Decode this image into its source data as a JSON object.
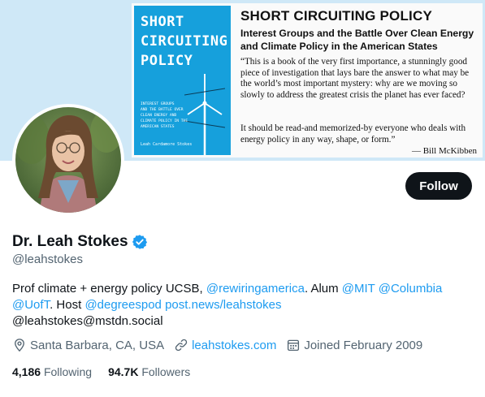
{
  "banner": {
    "book": {
      "title_lines": [
        "SHORT",
        "CIRCUITING",
        "POLICY"
      ],
      "subtitle_lines": [
        "INTEREST GROUPS",
        "AND THE BATTLE OVER",
        "CLEAN ENERGY AND",
        "CLIMATE POLICY IN THE",
        "AMERICAN STATES"
      ],
      "author": "Leah Cardamore Stokes"
    },
    "title": "SHORT CIRCUITING POLICY",
    "subtitle": "Interest Groups and the Battle Over Clean Energy and Climate Policy in the American States",
    "quote1": "“This is a book of the very first importance, a stunningly good piece of investigation that lays bare the answer to what may be the world’s most important mystery: why are we moving so slowly to address the greatest crisis the planet has ever faced?",
    "quote2": "It should be read-and memorized-by everyone who deals with energy policy in any way, shape, or form.”",
    "quote_author": "— Bill McKibben"
  },
  "profile": {
    "follow_label": "Follow",
    "display_name": "Dr. Leah Stokes",
    "handle": "@leahstokes",
    "bio": {
      "t1": "Prof climate + energy policy UCSB, ",
      "l1": "@rewiringamerica",
      "t2": ". Alum ",
      "l2": "@MIT",
      "t3": " ",
      "l3": "@Columbia",
      "t4": " ",
      "l4": "@UofT",
      "t5": ". Host ",
      "l5": "@degreespod",
      "t6": " ",
      "l6": "post.news/leahstokes",
      "line3": "@leahstokes@mstdn.social"
    },
    "location": "Santa Barbara, CA, USA",
    "website": "leahstokes.com",
    "joined": "Joined February 2009",
    "following_count": "4,186",
    "following_label": "Following",
    "followers_count": "94.7K",
    "followers_label": "Followers"
  },
  "colors": {
    "accent": "#1d9bf0",
    "text": "#0f1419",
    "muted": "#536471",
    "book_blue": "#16a0dc"
  },
  "icons": [
    "verified-badge-icon",
    "location-pin-icon",
    "link-icon",
    "calendar-icon"
  ]
}
